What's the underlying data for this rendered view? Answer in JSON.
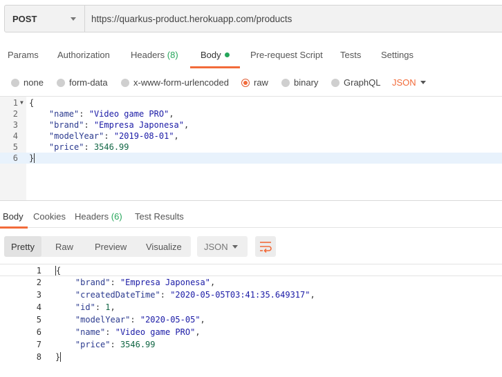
{
  "request": {
    "method": "POST",
    "url": "https://quarkus-product.herokuapp.com/products"
  },
  "request_tabs": {
    "params": "Params",
    "authorization": "Authorization",
    "headers_label": "Headers",
    "headers_count": "(8)",
    "body": "Body",
    "pre_request": "Pre-request Script",
    "tests": "Tests",
    "settings": "Settings"
  },
  "body_options": {
    "none": "none",
    "form_data": "form-data",
    "urlencoded": "x-www-form-urlencoded",
    "raw": "raw",
    "binary": "binary",
    "graphql": "GraphQL",
    "selected_type": "JSON"
  },
  "request_body": {
    "line_numbers": [
      "1",
      "2",
      "3",
      "4",
      "5",
      "6"
    ],
    "l1": "{",
    "l2_key": "\"name\"",
    "l2_val": "\"Video game PRO\"",
    "l3_key": "\"brand\"",
    "l3_val": "\"Empresa Japonesa\"",
    "l4_key": "\"modelYear\"",
    "l4_val": "\"2019-08-01\"",
    "l5_key": "\"price\"",
    "l5_val": "3546.99",
    "l6": "}"
  },
  "response_tabs": {
    "body": "Body",
    "cookies": "Cookies",
    "headers_label": "Headers",
    "headers_count": "(6)",
    "test_results": "Test Results"
  },
  "response_toolbar": {
    "pretty": "Pretty",
    "raw": "Raw",
    "preview": "Preview",
    "visualize": "Visualize",
    "format": "JSON",
    "wrap_icon": "wrap-lines-icon"
  },
  "response_body": {
    "line_numbers": [
      "1",
      "2",
      "3",
      "4",
      "5",
      "6",
      "7",
      "8"
    ],
    "l1": "{",
    "l2_key": "\"brand\"",
    "l2_val": "\"Empresa Japonesa\"",
    "l3_key": "\"createdDateTime\"",
    "l3_val": "\"2020-05-05T03:41:35.649317\"",
    "l4_key": "\"id\"",
    "l4_val": "1",
    "l5_key": "\"modelYear\"",
    "l5_val": "\"2020-05-05\"",
    "l6_key": "\"name\"",
    "l6_val": "\"Video game PRO\"",
    "l7_key": "\"price\"",
    "l7_val": "3546.99",
    "l8": "}"
  },
  "colors": {
    "accent": "#f26b3a",
    "count_green": "#26a65b",
    "string_blue": "#1a1aa6",
    "number_green": "#116644"
  }
}
